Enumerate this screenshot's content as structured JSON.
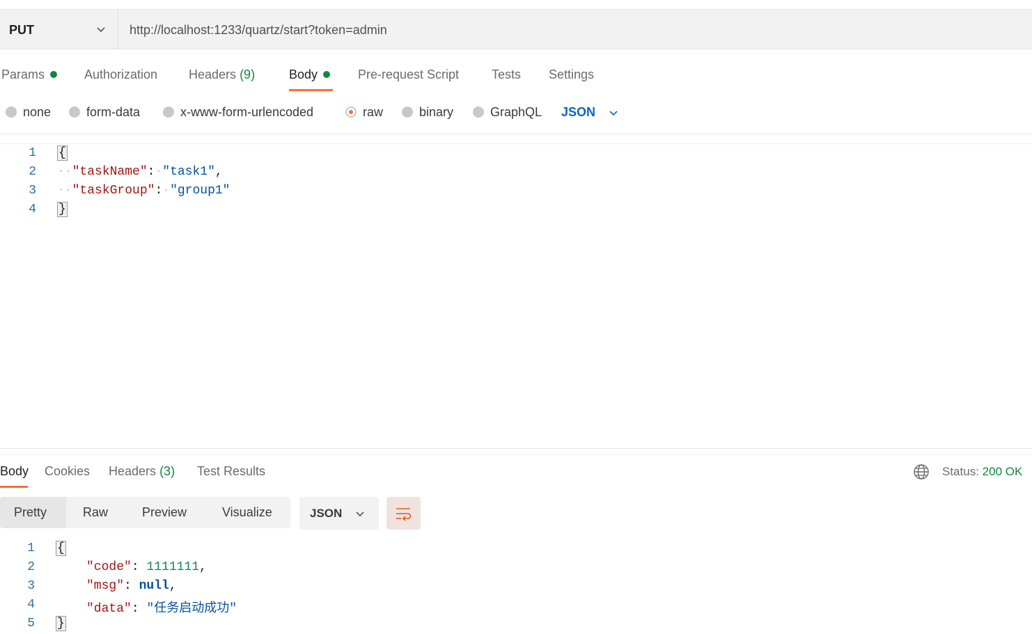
{
  "request": {
    "method": "PUT",
    "url": "http://localhost:1233/quartz/start?token=admin",
    "tabs": {
      "params": "Params",
      "authorization": "Authorization",
      "headers": "Headers",
      "headers_count": "(9)",
      "body": "Body",
      "pre_request": "Pre-request Script",
      "tests": "Tests",
      "settings": "Settings"
    },
    "body_types": {
      "none": "none",
      "form_data": "form-data",
      "urlencoded": "x-www-form-urlencoded",
      "raw": "raw",
      "binary": "binary",
      "graphql": "GraphQL",
      "selected": "raw",
      "format": "JSON"
    },
    "editor": {
      "line_numbers": [
        "1",
        "2",
        "3",
        "4"
      ],
      "open_brace": "{",
      "key1": "\"taskName\"",
      "val1": "\"task1\"",
      "key2": "\"taskGroup\"",
      "val2": "\"group1\"",
      "close_brace": "}"
    }
  },
  "response": {
    "tabs": {
      "body": "Body",
      "cookies": "Cookies",
      "headers": "Headers",
      "headers_count": "(3)",
      "test_results": "Test Results"
    },
    "status_label": "Status:",
    "status_value": "200 OK",
    "views": {
      "pretty": "Pretty",
      "raw": "Raw",
      "preview": "Preview",
      "visualize": "Visualize",
      "selected": "Pretty"
    },
    "format": "JSON",
    "editor": {
      "line_numbers": [
        "1",
        "2",
        "3",
        "4",
        "5"
      ],
      "open_brace": "{",
      "key1": "\"code\"",
      "val1": "1111111",
      "key2": "\"msg\"",
      "val2": "null",
      "key3": "\"data\"",
      "val3": "\"任务启动成功\"",
      "close_brace": "}"
    }
  },
  "colors": {
    "accent": "#ff6c37",
    "success": "#0b8a3e",
    "link": "#0b65c2"
  }
}
